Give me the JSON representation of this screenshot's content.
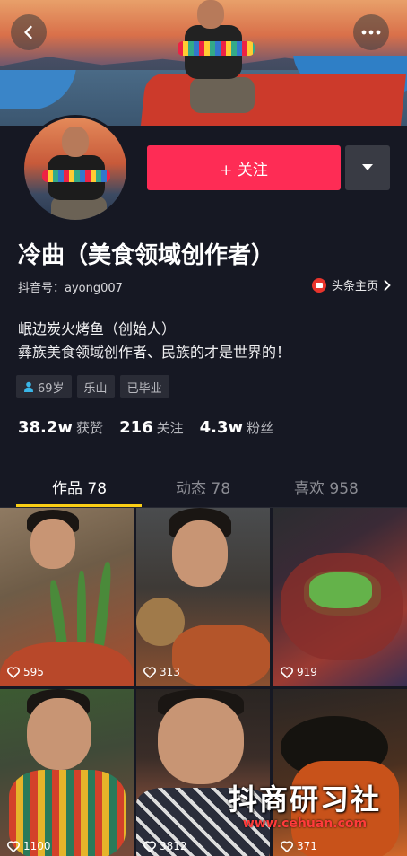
{
  "header": {
    "back_icon": "chevron-left-icon",
    "more_icon": "ellipsis-icon"
  },
  "profile": {
    "follow_label": "+ 关注",
    "dropdown_icon": "caret-down-icon",
    "nickname": "冷曲（美食领域创作者）",
    "account_label": "抖音号：ayong007",
    "toutiao_label": "头条主页",
    "bio_line1": "岷边炭火烤鱼（创始人）",
    "bio_line2": "彝族美食领域创作者、民族的才是世界的！",
    "tags": {
      "age": "69岁",
      "city": "乐山",
      "status": "已毕业"
    },
    "stats": {
      "likes_num": "38.2w",
      "likes_label": "获赞",
      "following_num": "216",
      "following_label": "关注",
      "fans_num": "4.3w",
      "fans_label": "粉丝"
    }
  },
  "tabs": {
    "works": "作品 78",
    "dynamic": "动态 78",
    "liked": "喜欢 958"
  },
  "videos": [
    {
      "likes": "595"
    },
    {
      "likes": "313"
    },
    {
      "likes": "919"
    },
    {
      "likes": "1100"
    },
    {
      "likes": "3812"
    },
    {
      "likes": "371"
    }
  ],
  "watermark": {
    "title": "抖商研习社",
    "url": "www.cehuan.com"
  },
  "colors": {
    "background": "#161823",
    "follow": "#fe2c55",
    "tab_indicator": "#face15"
  }
}
